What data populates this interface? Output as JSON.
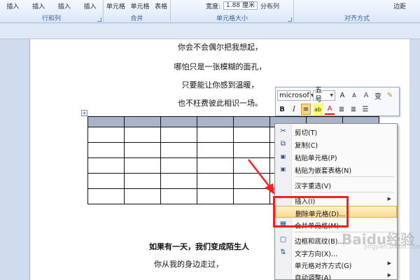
{
  "ribbon": {
    "groups": [
      {
        "label": "行和列",
        "buttons": [
          "插入",
          "插入",
          "插入",
          "插入"
        ]
      },
      {
        "label": "合并",
        "buttons": [
          "单元格",
          "单元格",
          "表格"
        ]
      },
      {
        "label": "单元格大小",
        "width_label": "宽度:",
        "width_value": "1.88 厘米",
        "distribute": "分布列"
      },
      {
        "label": "对齐方式",
        "margin": "边距"
      }
    ]
  },
  "document": {
    "lines_top": [
      "你会不会偶尔把我想起，",
      "哪怕只是一张模糊的面孔，",
      "只要能让你感到温暖，",
      "也不枉费彼此相识一场。"
    ],
    "lines_bottom": [
      "如果有一天，我们变成陌生人",
      "你从我的身边走过，"
    ]
  },
  "mini_toolbar": {
    "font": "microsof",
    "size": "五号",
    "buttons_row1": [
      "A",
      "A",
      "A",
      "变",
      "✎"
    ],
    "buttons_row2": [
      "B",
      "I",
      "≡",
      "ab",
      "A",
      "≣",
      "≣",
      "☰"
    ]
  },
  "context_menu": {
    "items": [
      {
        "label": "剪切(T)",
        "icon": "scissors-icon",
        "glyph": "✂"
      },
      {
        "label": "复制(C)",
        "icon": "copy-icon",
        "glyph": "⧉"
      },
      {
        "label": "粘贴单元格(P)",
        "icon": "paste-icon",
        "glyph": "📋"
      },
      {
        "label": "粘贴为嵌套表格(N)",
        "icon": "paste-nested-icon",
        "glyph": "📋"
      },
      {
        "label": "汉字重选(V)",
        "icon": "",
        "glyph": ""
      },
      {
        "label": "插入(I)",
        "icon": "",
        "glyph": "",
        "submenu": true
      },
      {
        "label": "删除单元格(D)...",
        "icon": "",
        "glyph": "",
        "highlighted": true
      },
      {
        "label": "合并单元格(M)",
        "icon": "merge-cells-icon",
        "glyph": "▦"
      },
      {
        "label": "边框和底纹(B)...",
        "icon": "borders-icon",
        "glyph": "▢"
      },
      {
        "label": "文字方向(X)...",
        "icon": "text-direction-icon",
        "glyph": "⇅"
      },
      {
        "label": "单元格对齐方式(G)",
        "icon": "",
        "glyph": "",
        "submenu": true
      },
      {
        "label": "自动调整(A)",
        "icon": "",
        "glyph": "",
        "submenu": true
      }
    ]
  },
  "watermark": {
    "main": "Baidu经验",
    "sub": "jingyan.baidu.com"
  },
  "colors": {
    "highlight": "#fbdc8c",
    "annotation": "#ff1d1d",
    "selected_row": "#aab4c8"
  }
}
